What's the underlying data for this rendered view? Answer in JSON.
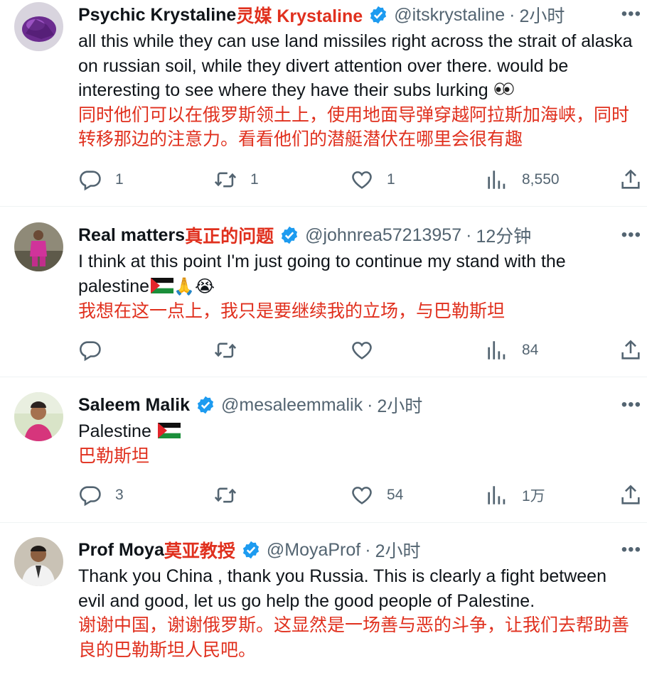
{
  "tweets": [
    {
      "name": "Psychic Krystaline",
      "name_cn": "灵媒 Krystaline",
      "handle": "@itskrystaline",
      "time": "2小时",
      "text_en": "all this while they can use land missiles right across the strait of alaska on russian soil, while they divert attention over there. would be interesting to see where they have their subs lurking",
      "text_cn": "同时他们可以在俄罗斯领土上，使用地面导弹穿越阿拉斯加海峡，同时转移那边的注意力。看看他们的潜艇潜伏在哪里会很有趣",
      "replies": "1",
      "retweets": "1",
      "likes": "1",
      "views": "8,550"
    },
    {
      "name": "Real matters",
      "name_cn": "真正的问题",
      "handle": "@johnrea57213957",
      "time": "12分钟",
      "text_en": "I think at this point I'm just going to continue my stand with the palestine",
      "text_cn": "我想在这一点上，我只是要继续我的立场，与巴勒斯坦",
      "replies": "",
      "retweets": "",
      "likes": "",
      "views": "84"
    },
    {
      "name": "Saleem Malik",
      "name_cn": "",
      "handle": "@mesaleemmalik",
      "time": "2小时",
      "text_en": "Palestine",
      "text_cn": "巴勒斯坦",
      "replies": "3",
      "retweets": "",
      "likes": "54",
      "views": "1万"
    },
    {
      "name": "Prof Moya",
      "name_cn": "莫亚教授",
      "handle": "@MoyaProf",
      "time": "2小时",
      "text_en": "Thank you China , thank you Russia. This is clearly a fight between evil and good, let us go help the good people of Palestine.",
      "text_cn": "谢谢中国，谢谢俄罗斯。这显然是一场善与恶的斗争，让我们去帮助善良的巴勒斯坦人民吧。"
    }
  ],
  "icons": {
    "reply": "reply-icon",
    "retweet": "retweet-icon",
    "like": "heart-icon",
    "views": "views-icon",
    "share": "share-icon",
    "more": "more-icon",
    "verified": "verified-badge-icon"
  },
  "colors": {
    "translation": "#e0301e",
    "verified": "#1d9bf0",
    "secondary": "#536471"
  }
}
